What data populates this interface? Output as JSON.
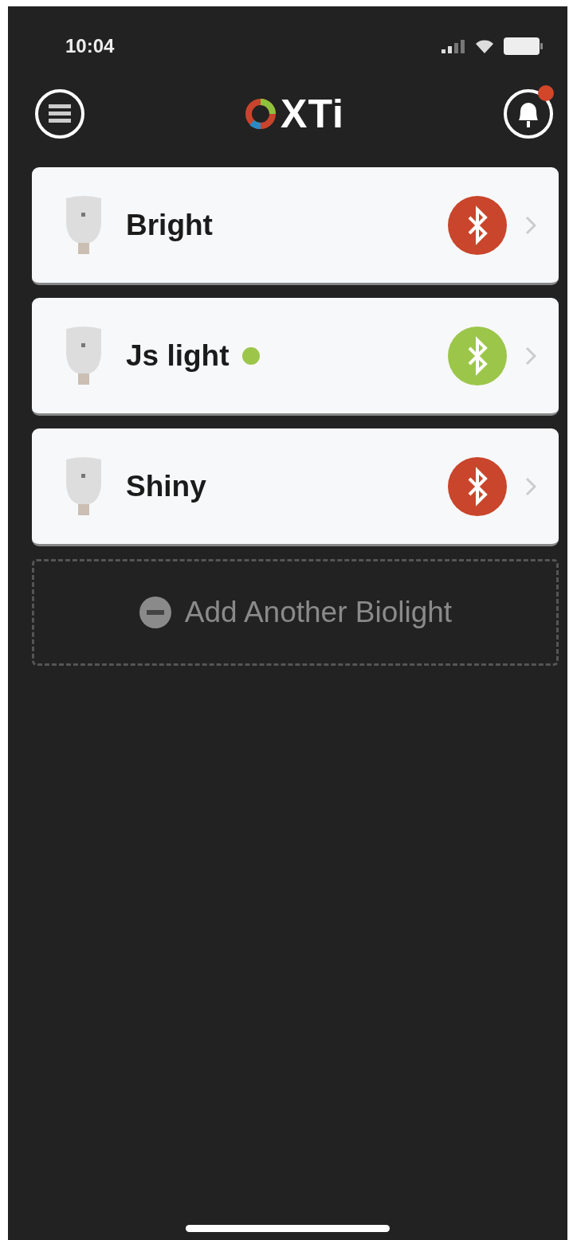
{
  "status_bar": {
    "time": "10:04"
  },
  "header": {
    "logo": "XTi",
    "notification_badge": true
  },
  "devices": [
    {
      "name": "Bright",
      "online": false,
      "connected": false
    },
    {
      "name": "Js light",
      "online": true,
      "connected": true
    },
    {
      "name": "Shiny",
      "online": false,
      "connected": false
    }
  ],
  "add_button": {
    "label": "Add Another Biolight"
  }
}
